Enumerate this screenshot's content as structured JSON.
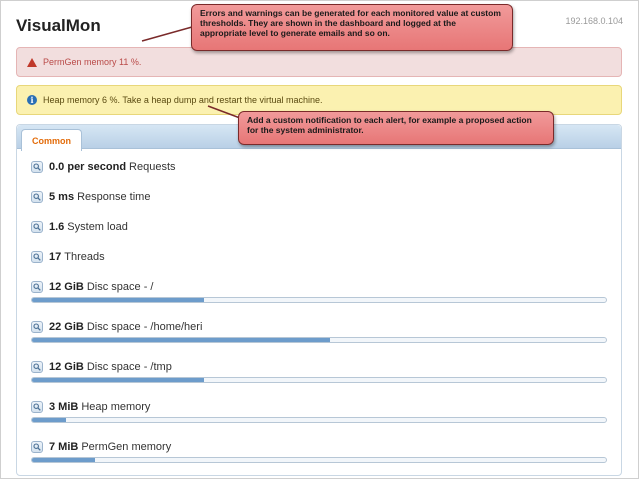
{
  "app": {
    "title": "VisualMon",
    "host": "192.168.0.104"
  },
  "alerts": {
    "error": {
      "text": "PermGen memory 11 %.",
      "icon": "warning-triangle-icon"
    },
    "warning": {
      "text": "Heap memory 6 %. Take a heap dump and restart the virtual machine.",
      "icon": "info-icon"
    }
  },
  "panel": {
    "tab_label": "Common"
  },
  "metrics": [
    {
      "value": "0.0 per second",
      "label": "Requests",
      "icon": "magnifier-icon"
    },
    {
      "value": "5 ms",
      "label": "Response time",
      "icon": "magnifier-icon"
    },
    {
      "value": "1.6",
      "label": "System load",
      "icon": "magnifier-icon"
    },
    {
      "value": "17",
      "label": "Threads",
      "icon": "magnifier-icon"
    },
    {
      "value": "12 GiB",
      "label": "Disc space - /",
      "icon": "magnifier-icon",
      "usage_percent": 30
    },
    {
      "value": "22 GiB",
      "label": "Disc space - /home/heri",
      "icon": "magnifier-icon",
      "usage_percent": 52
    },
    {
      "value": "12 GiB",
      "label": "Disc space - /tmp",
      "icon": "magnifier-icon",
      "usage_percent": 30
    },
    {
      "value": "3 MiB",
      "label": "Heap memory",
      "icon": "magnifier-icon",
      "usage_percent": 6
    },
    {
      "value": "7 MiB",
      "label": "PermGen memory",
      "icon": "magnifier-icon",
      "usage_percent": 11
    }
  ],
  "callouts": {
    "thresholds": "Errors and warnings can be generated for each monitored value at custom thresholds. They are shown in the dashboard and logged at the appropriate level to generate emails and so on.",
    "notification": "Add a custom notification to each alert, for example a proposed action for the system administrator."
  },
  "colors": {
    "bar_fill": "#6d9ccb",
    "tab_text": "#e36c0a",
    "error_text": "#b94a48",
    "callout_bg": "#e77676"
  }
}
